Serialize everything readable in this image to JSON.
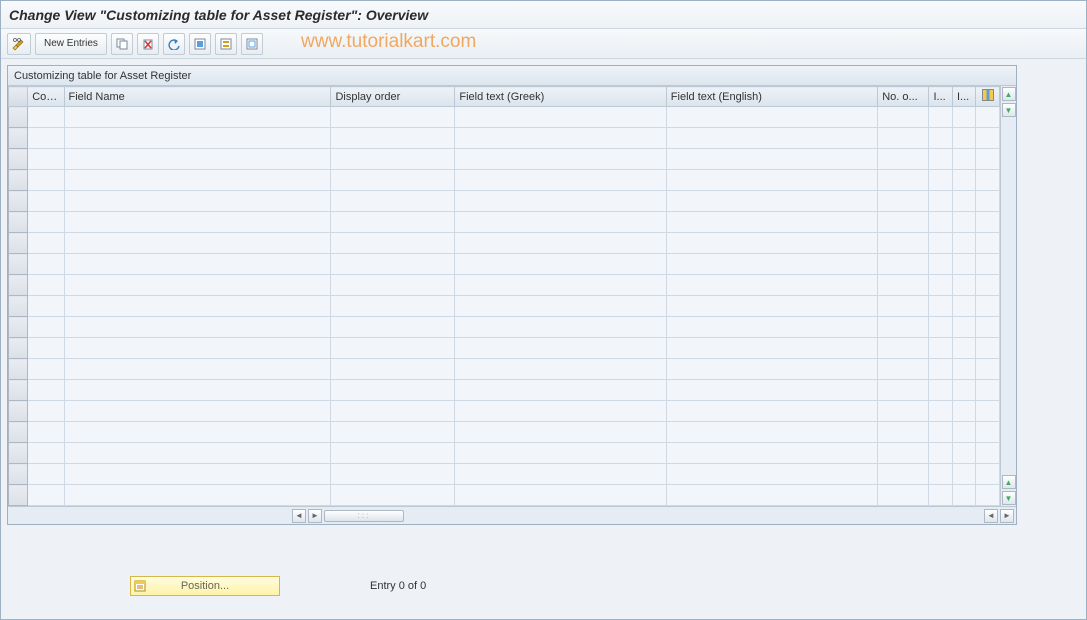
{
  "title": "Change View \"Customizing table for Asset Register\": Overview",
  "watermark": "www.tutorialkart.com",
  "toolbar": {
    "new_entries_label": "New Entries"
  },
  "panel": {
    "caption": "Customizing table for Asset Register"
  },
  "columns": {
    "cocd": "CoCd",
    "field_name": "Field Name",
    "display_order": "Display order",
    "field_text_greek": "Field text (Greek)",
    "field_text_english": "Field text (English)",
    "no_o": "No. o...",
    "i1": "I...",
    "i2": "I..."
  },
  "rows": [
    {},
    {},
    {},
    {},
    {},
    {},
    {},
    {},
    {},
    {},
    {},
    {},
    {},
    {},
    {},
    {},
    {},
    {},
    {}
  ],
  "footer": {
    "position_label": "Position...",
    "entry_text": "Entry 0 of 0"
  }
}
